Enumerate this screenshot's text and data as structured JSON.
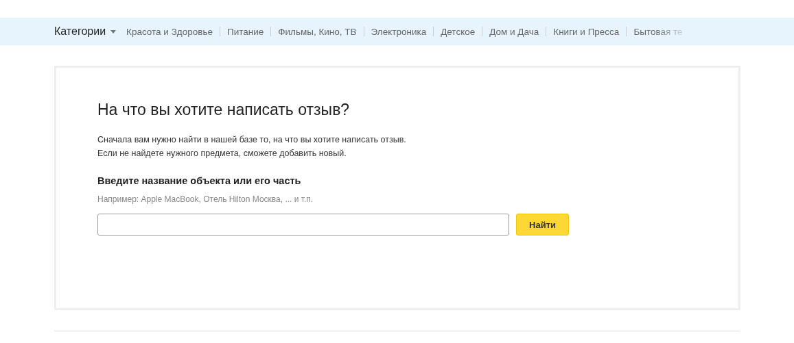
{
  "nav": {
    "categories_label": "Категории",
    "items": [
      "Красота и Здоровье",
      "Питание",
      "Фильмы, Кино, ТВ",
      "Электроника",
      "Детское",
      "Дом и Дача",
      "Книги и Пресса",
      "Бытовая те"
    ]
  },
  "card": {
    "title": "На что вы хотите написать отзыв?",
    "intro": [
      "Сначала вам нужно найти в нашей базе то, на что вы хотите написать отзыв.",
      "Если не найдете нужного предмета, сможете добавить новый."
    ],
    "label": "Введите название объекта или его часть",
    "hint": "Например: Apple MacBook, Отель Hilton Москва, ... и т.п.",
    "button": "Найти"
  }
}
